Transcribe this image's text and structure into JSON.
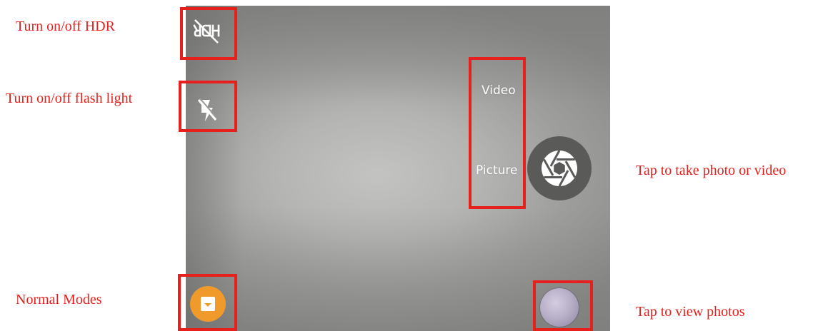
{
  "annotations": {
    "hdr": "Turn on/off HDR",
    "flash": "Turn on/off flash light",
    "modes": "Normal Modes",
    "shutter": "Tap to take photo or video",
    "gallery": "Tap to view photos"
  },
  "camera": {
    "modes": {
      "video_label": "Video",
      "picture_label": "Picture"
    },
    "icons": {
      "hdr": "hdr-off-icon",
      "flash": "flash-off-icon",
      "shutter": "camera-aperture-icon",
      "modes": "modes-icon",
      "gallery": "gallery-thumbnail"
    }
  },
  "colors": {
    "annotation": "#e6201c",
    "shutter_bg": "#5a5a58",
    "modes_bg": "#ef9a2a"
  }
}
